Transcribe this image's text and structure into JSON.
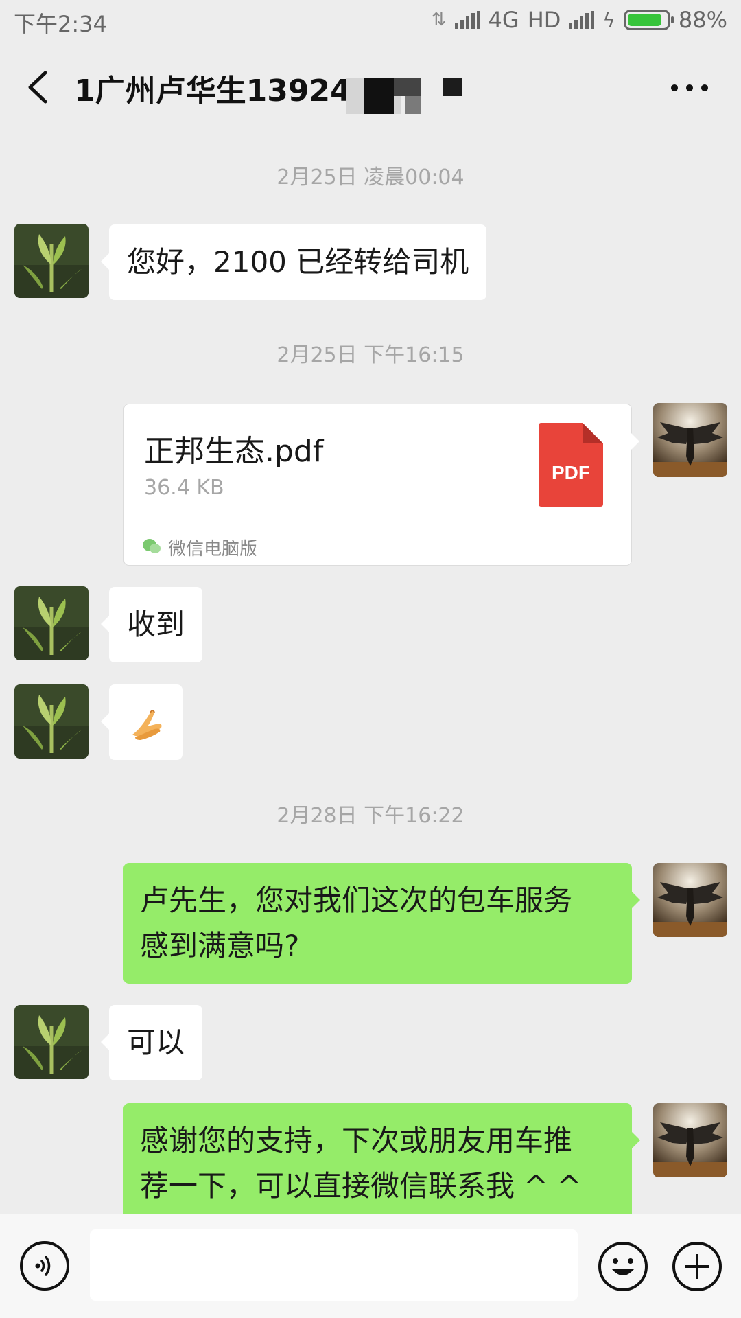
{
  "status_bar": {
    "time": "下午2:34",
    "network": "4G",
    "hd": "HD",
    "battery": "88%",
    "battery_level": 0.88
  },
  "header": {
    "title": "1广州卢华生13924"
  },
  "messages": [
    {
      "type": "timestamp",
      "text": "2月25日 凌晨00:04"
    },
    {
      "type": "text",
      "side": "in",
      "text": "您好，2100 已经转给司机"
    },
    {
      "type": "timestamp",
      "text": "2月25日 下午16:15"
    },
    {
      "type": "file",
      "side": "out",
      "file_name": "正邦生态.pdf",
      "file_size": "36.4 KB",
      "file_icon_label": "PDF",
      "source": "微信电脑版"
    },
    {
      "type": "text",
      "side": "in",
      "text": "收到"
    },
    {
      "type": "emoji",
      "side": "in",
      "emoji": "folded-hands-icon"
    },
    {
      "type": "timestamp",
      "text": "2月28日 下午16:22"
    },
    {
      "type": "text",
      "side": "out",
      "text_lines": [
        "卢先生，您对我们这次的包车服务",
        "感到满意吗?"
      ]
    },
    {
      "type": "text",
      "side": "in",
      "text": "可以"
    },
    {
      "type": "text",
      "side": "out",
      "text_lines": [
        "感谢您的支持，下次或朋友用车推",
        "荐一下，可以直接微信联系我 ^ ^"
      ]
    }
  ],
  "input_bar": {
    "value": ""
  },
  "colors": {
    "background": "#ededed",
    "bubble_out": "#95ec69",
    "bubble_in": "#ffffff",
    "pdf_red": "#e8443a"
  }
}
